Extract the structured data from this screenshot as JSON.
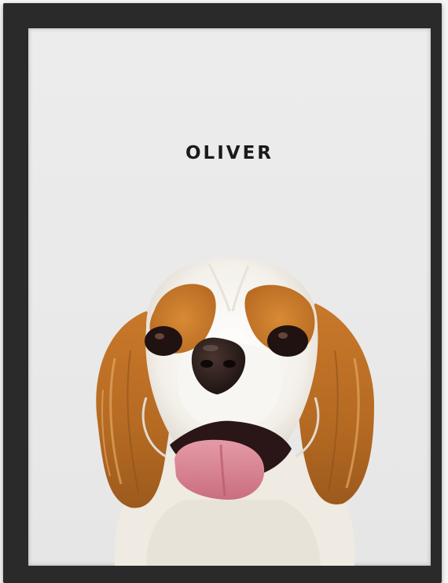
{
  "poster": {
    "pet_name": "OLIVER"
  },
  "colors": {
    "frame": "#2a2a2a",
    "mat": "#ebebeb",
    "fur_orange": "#c97a2c",
    "fur_white": "#f7f5f0",
    "tongue": "#d97f8e"
  }
}
